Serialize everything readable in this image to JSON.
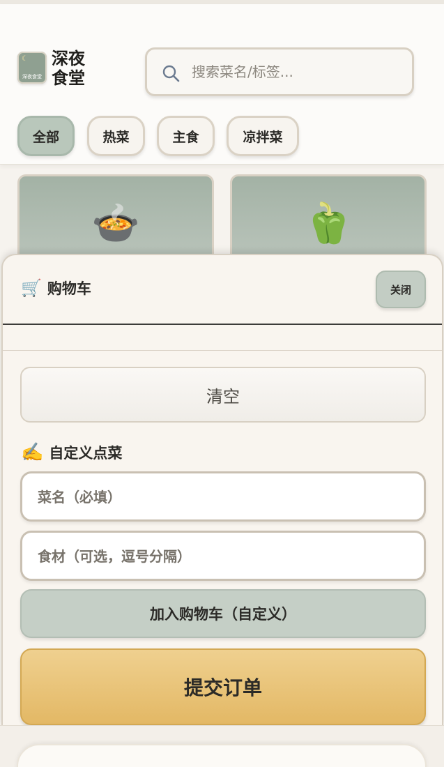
{
  "header": {
    "logo_text": "深夜食堂",
    "logo_icon": "moon-icon",
    "brand_line1": "深夜",
    "brand_line2": "食堂",
    "search_placeholder": "搜索菜名/标签..."
  },
  "categories": [
    {
      "label": "全部",
      "active": true
    },
    {
      "label": "热菜",
      "active": false
    },
    {
      "label": "主食",
      "active": false
    },
    {
      "label": "凉拌菜",
      "active": false
    }
  ],
  "dishes": [
    {
      "emoji": "🍲",
      "icon": "soup-bowl-icon"
    },
    {
      "emoji": "🫑",
      "icon": "bell-pepper-icon"
    }
  ],
  "cart": {
    "icon": "🛒",
    "title": "购物车",
    "close_label": "关闭",
    "clear_label": "清空",
    "custom_icon": "✍️",
    "custom_title": "自定义点菜",
    "dish_name_placeholder": "菜名（必填）",
    "ingredients_placeholder": "食材（可选，逗号分隔）",
    "add_custom_label": "加入购物车（自定义）",
    "submit_label": "提交订单"
  },
  "colors": {
    "accent_green": "#b9c7bb",
    "submit_gold": "#e3b865",
    "background": "#f6f3ee"
  }
}
